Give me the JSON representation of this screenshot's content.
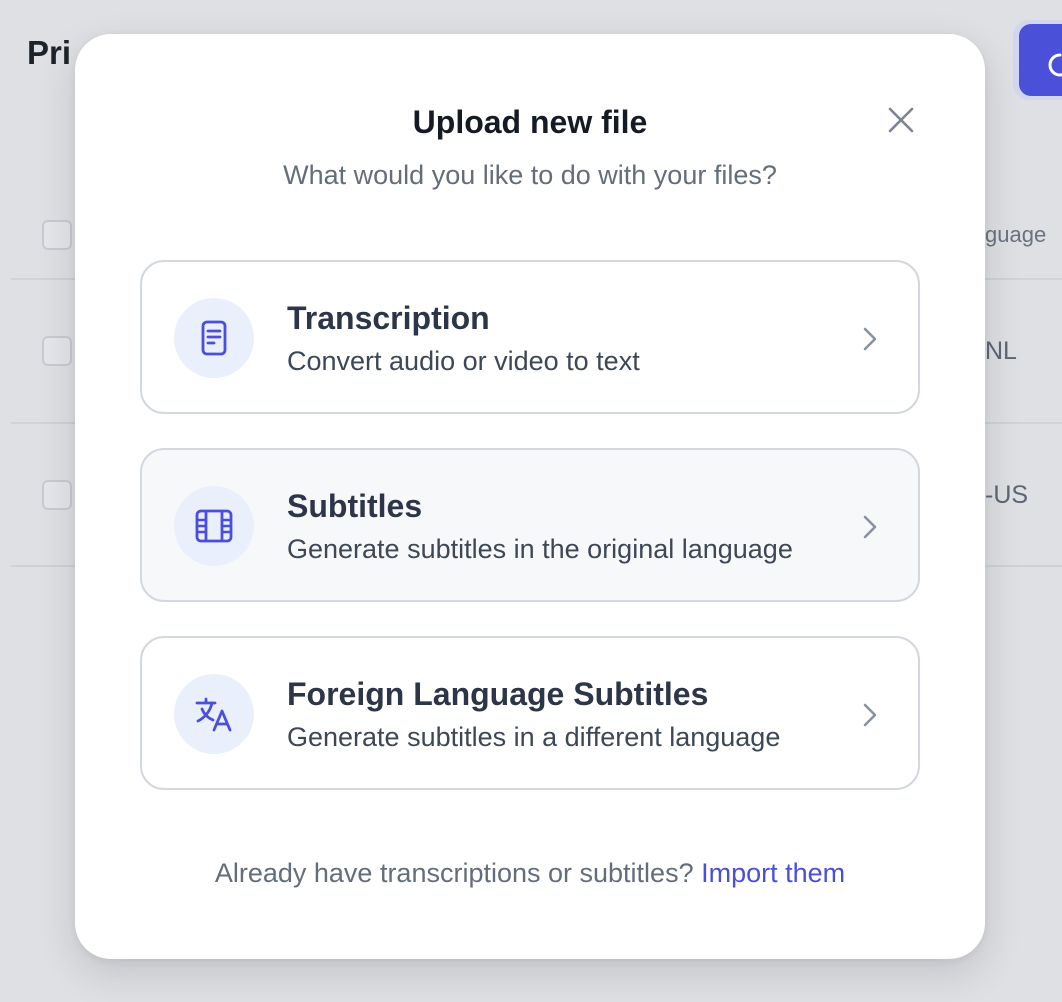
{
  "background": {
    "page_title_fragment": "Pri",
    "column_header_fragment": "guage",
    "rows": [
      {
        "language_fragment": "NL"
      },
      {
        "language_fragment": "-US"
      }
    ]
  },
  "modal": {
    "title": "Upload new file",
    "subtitle": "What would you like to do with your files?",
    "close_icon": "close-icon",
    "options": [
      {
        "title": "Transcription",
        "description": "Convert audio or video to text",
        "icon": "document-icon"
      },
      {
        "title": "Subtitles",
        "description": "Generate subtitles in the original language",
        "icon": "film-icon"
      },
      {
        "title": "Foreign Language Subtitles",
        "description": "Generate subtitles in a different language",
        "icon": "translate-icon"
      }
    ],
    "footer_text": "Already have transcriptions or subtitles?",
    "footer_link": "Import them"
  },
  "colors": {
    "accent": "#4a4fdb",
    "icon_bg": "#eaeffc",
    "card_border": "#d3d8df",
    "backdrop": "#dee0e3"
  }
}
